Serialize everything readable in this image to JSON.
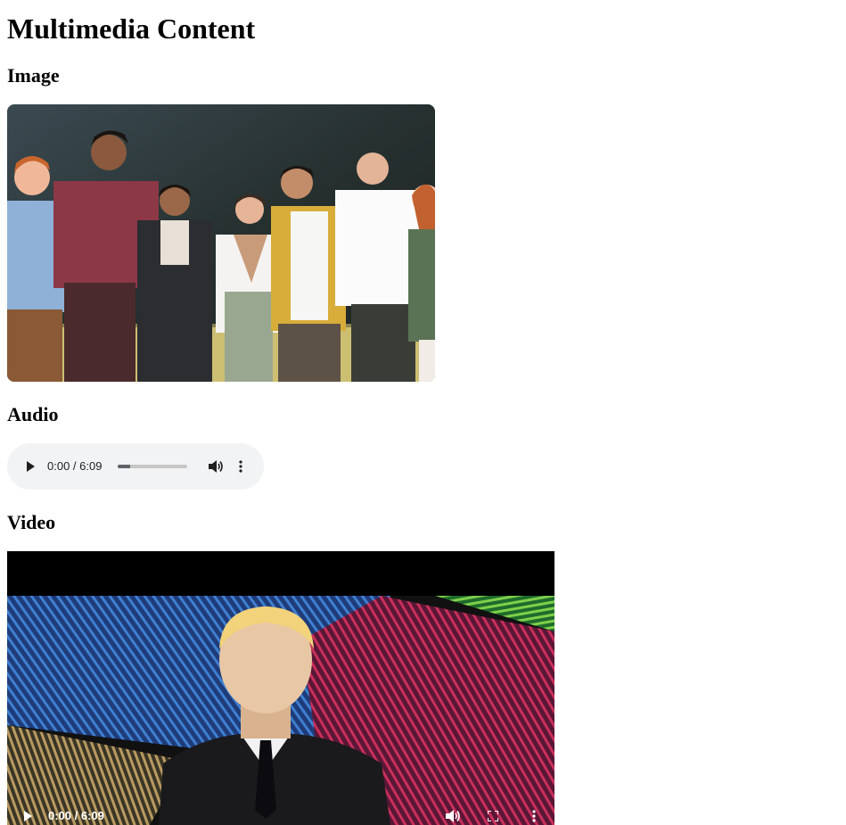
{
  "page": {
    "title": "Multimedia Content"
  },
  "image_section": {
    "heading": "Image",
    "image": {
      "alt": "Group of people standing arm in arm in front of a chalkboard"
    }
  },
  "audio_section": {
    "heading": "Audio",
    "player": {
      "current_time": "0:00",
      "separator": " / ",
      "duration": "6:09",
      "buffered_fraction": 0.18,
      "icons": [
        "play-icon",
        "volume-icon",
        "more-options-icon"
      ]
    }
  },
  "video_section": {
    "heading": "Video",
    "player": {
      "current_time": "0:00",
      "separator": " / ",
      "duration": "6:09",
      "icons": [
        "play-icon",
        "volume-icon",
        "fullscreen-icon",
        "more-options-icon"
      ]
    }
  },
  "colors": {
    "audio_bg": "#f1f3f4",
    "audio_track": "#c6c6c6",
    "audio_buffer": "#5f6368",
    "video_bg": "#000000"
  }
}
